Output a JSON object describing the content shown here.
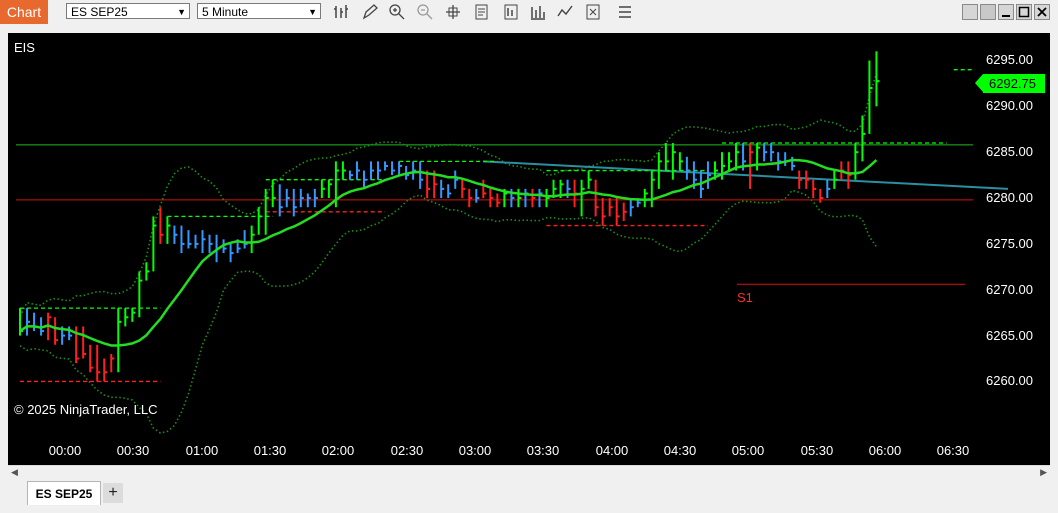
{
  "window": {
    "tab_label": "Chart",
    "tab_color": "#e8692d"
  },
  "toolbar": {
    "instrument_select": "ES SEP25",
    "interval_select": "5 Minute",
    "icons": [
      "bar-type-icon",
      "drawing-tool-icon",
      "zoom-in-icon",
      "zoom-out-icon",
      "crosshair-icon",
      "data-box-icon",
      "chart-properties-icon",
      "strategies-icon",
      "indicators-icon",
      "chart-trader-icon",
      "more-icon"
    ]
  },
  "chart": {
    "instrument_label": "EIS",
    "copyright": "© 2025 NinjaTrader, LLC",
    "annotation_s1": "S1",
    "current_price": "6292.75",
    "price_axis": [
      "6295.00",
      "6290.00",
      "6285.00",
      "6280.00",
      "6275.00",
      "6270.00",
      "6265.00",
      "6260.00"
    ],
    "time_axis": [
      "00:00",
      "00:30",
      "01:00",
      "01:30",
      "02:00",
      "02:30",
      "03:00",
      "03:30",
      "04:00",
      "04:30",
      "05:00",
      "05:30",
      "06:00",
      "06:30"
    ],
    "colors": {
      "up": "#00ff00",
      "down": "#ff2020",
      "neutral": "#3399ff",
      "ma": "#22dd22",
      "bollinger": "#1a8f1a",
      "resistance": "#22bb22",
      "support": "#dd1111",
      "trend": "#2a8fa0"
    }
  },
  "chart_data": {
    "type": "ohlc",
    "y_range": [
      6257,
      6298
    ],
    "bars": [
      [
        6268,
        6265,
        6265.5,
        "g"
      ],
      [
        6268,
        6265,
        6266.5,
        "b"
      ],
      [
        6267.5,
        6265.5,
        6266,
        "b"
      ],
      [
        6267,
        6265,
        6265.5,
        "b"
      ],
      [
        6267.5,
        6264.5,
        6267,
        "r"
      ],
      [
        6267,
        6264,
        6264.5,
        "r"
      ],
      [
        6266,
        6264,
        6265,
        "b"
      ],
      [
        6266,
        6264.5,
        6265,
        "b"
      ],
      [
        6266,
        6262,
        6262.5,
        "r"
      ],
      [
        6266,
        6262.5,
        6263,
        "r"
      ],
      [
        6264,
        6261,
        6261.5,
        "r"
      ],
      [
        6264,
        6260,
        6261,
        "r"
      ],
      [
        6262.5,
        6260,
        6261,
        "r"
      ],
      [
        6263,
        6261,
        6262.5,
        "r"
      ],
      [
        6268,
        6261,
        6266.5,
        "g"
      ],
      [
        6268,
        6266,
        6267,
        "g"
      ],
      [
        6268,
        6266.5,
        6267.5,
        "g"
      ],
      [
        6272,
        6267,
        6271,
        "g"
      ],
      [
        6273,
        6271,
        6272,
        "g"
      ],
      [
        6278,
        6272,
        6277,
        "g"
      ],
      [
        6279,
        6275,
        6276,
        "r"
      ],
      [
        6278,
        6275,
        6277,
        "g"
      ],
      [
        6277,
        6275,
        6276,
        "b"
      ],
      [
        6277,
        6274,
        6275,
        "b"
      ],
      [
        6276.5,
        6274.5,
        6275,
        "b"
      ],
      [
        6276,
        6274.5,
        6275,
        "b"
      ],
      [
        6276.5,
        6274,
        6275.5,
        "b"
      ],
      [
        6276,
        6274,
        6275,
        "b"
      ],
      [
        6276,
        6273,
        6274.5,
        "b"
      ],
      [
        6275.5,
        6274,
        6274.5,
        "b"
      ],
      [
        6275,
        6273,
        6274,
        "b"
      ],
      [
        6275.5,
        6274,
        6274.5,
        "b"
      ],
      [
        6276.5,
        6274.5,
        6275,
        "b"
      ],
      [
        6277,
        6274,
        6276,
        "g"
      ],
      [
        6279,
        6276,
        6278,
        "g"
      ],
      [
        6281,
        6276,
        6280,
        "g"
      ],
      [
        6282,
        6279,
        6280,
        "g"
      ],
      [
        6281.5,
        6278,
        6279,
        "b"
      ],
      [
        6281,
        6279,
        6280,
        "b"
      ],
      [
        6281,
        6278,
        6279,
        "b"
      ],
      [
        6281,
        6279,
        6280,
        "b"
      ],
      [
        6280.5,
        6279,
        6280,
        "b"
      ],
      [
        6281,
        6279,
        6280,
        "b"
      ],
      [
        6282,
        6280,
        6281,
        "g"
      ],
      [
        6282,
        6280,
        6281.5,
        "g"
      ],
      [
        6284,
        6279,
        6283,
        "g"
      ],
      [
        6284,
        6282,
        6283,
        "g"
      ],
      [
        6283,
        6282,
        6282.5,
        "b"
      ],
      [
        6284,
        6282,
        6283,
        "b"
      ],
      [
        6283,
        6281,
        6282,
        "b"
      ],
      [
        6284,
        6282,
        6283,
        "b"
      ],
      [
        6284,
        6282,
        6283,
        "b"
      ],
      [
        6284,
        6283,
        6283.5,
        "b"
      ],
      [
        6284,
        6282.5,
        6283,
        "b"
      ],
      [
        6284,
        6282.5,
        6283.5,
        "b"
      ],
      [
        6283.5,
        6282,
        6282.5,
        "b"
      ],
      [
        6284,
        6282,
        6283,
        "b"
      ],
      [
        6284,
        6281,
        6282,
        "b"
      ],
      [
        6283,
        6280,
        6281,
        "r"
      ],
      [
        6283,
        6280,
        6281.5,
        "r"
      ],
      [
        6282,
        6280,
        6281,
        "b"
      ],
      [
        6281.5,
        6280,
        6280.5,
        "b"
      ],
      [
        6283,
        6281,
        6282,
        "b"
      ],
      [
        6282,
        6280,
        6281,
        "r"
      ],
      [
        6281,
        6279,
        6280,
        "r"
      ],
      [
        6281,
        6279.5,
        6280,
        "b"
      ],
      [
        6282,
        6280,
        6280.5,
        "r"
      ],
      [
        6281,
        6279,
        6280,
        "r"
      ],
      [
        6280.5,
        6279,
        6279.5,
        "r"
      ],
      [
        6281,
        6279,
        6280.5,
        "g"
      ],
      [
        6281,
        6279,
        6280,
        "b"
      ],
      [
        6281,
        6279,
        6280,
        "g"
      ],
      [
        6281,
        6279,
        6280.5,
        "b"
      ],
      [
        6281,
        6279,
        6280,
        "r"
      ],
      [
        6281,
        6279,
        6280.5,
        "b"
      ],
      [
        6281,
        6279,
        6280,
        "g"
      ],
      [
        6282,
        6280,
        6281,
        "g"
      ],
      [
        6282,
        6280,
        6281.5,
        "g"
      ],
      [
        6282,
        6280,
        6281,
        "b"
      ],
      [
        6282,
        6279,
        6280.5,
        "r"
      ],
      [
        6282,
        6278,
        6281,
        "g"
      ],
      [
        6283,
        6281,
        6282,
        "g"
      ],
      [
        6282,
        6278,
        6279,
        "r"
      ],
      [
        6280,
        6277,
        6278,
        "r"
      ],
      [
        6280,
        6278,
        6279,
        "r"
      ],
      [
        6280,
        6277,
        6278,
        "r"
      ],
      [
        6279.5,
        6277.5,
        6278.5,
        "r"
      ],
      [
        6280,
        6278,
        6279,
        "b"
      ],
      [
        6280,
        6279,
        6279.5,
        "b"
      ],
      [
        6281,
        6279,
        6280.5,
        "g"
      ],
      [
        6283,
        6279,
        6282,
        "g"
      ],
      [
        6285,
        6281,
        6284,
        "g"
      ],
      [
        6286,
        6283,
        6284,
        "g"
      ],
      [
        6286,
        6282,
        6285,
        "g"
      ],
      [
        6285,
        6283,
        6284,
        "g"
      ],
      [
        6284.5,
        6282,
        6283,
        "b"
      ],
      [
        6284,
        6281,
        6282,
        "b"
      ],
      [
        6283,
        6280,
        6281,
        "b"
      ],
      [
        6284,
        6281,
        6282.5,
        "b"
      ],
      [
        6284,
        6282,
        6283,
        "g"
      ],
      [
        6285,
        6282,
        6283.5,
        "g"
      ],
      [
        6285,
        6283,
        6284,
        "g"
      ],
      [
        6286,
        6283,
        6285,
        "g"
      ],
      [
        6286,
        6283,
        6284,
        "b"
      ],
      [
        6286,
        6281,
        6285,
        "r"
      ],
      [
        6286,
        6283,
        6285.5,
        "g"
      ],
      [
        6286,
        6284,
        6285,
        "b"
      ],
      [
        6286,
        6284,
        6285,
        "b"
      ],
      [
        6285,
        6283,
        6284,
        "b"
      ],
      [
        6285,
        6283.5,
        6284,
        "b"
      ],
      [
        6284.5,
        6283,
        6283.5,
        "b"
      ],
      [
        6283,
        6281,
        6282,
        "r"
      ],
      [
        6283,
        6281,
        6282,
        "r"
      ],
      [
        6282,
        6280,
        6281,
        "r"
      ],
      [
        6281,
        6279.5,
        6280,
        "r"
      ],
      [
        6282,
        6280,
        6281,
        "b"
      ],
      [
        6283,
        6281,
        6282,
        "g"
      ],
      [
        6284,
        6282,
        6283,
        "r"
      ],
      [
        6284,
        6281,
        6282.5,
        "r"
      ],
      [
        6286,
        6282,
        6285,
        "g"
      ],
      [
        6289,
        6284,
        6287,
        "g"
      ],
      [
        6295,
        6287,
        6292,
        "g"
      ],
      [
        6296,
        6290,
        6292.75,
        "g"
      ]
    ],
    "moving_average": [
      [
        6266,
        6266
      ],
      [
        6265.5,
        6265.5
      ],
      [
        6266.5,
        6266.5
      ],
      [
        6270,
        6270
      ],
      [
        6272.5,
        6272.5
      ],
      [
        6274,
        6274
      ],
      [
        6274.5,
        6274.5
      ],
      [
        6276.5,
        6276.5
      ],
      [
        6278.5,
        6278.5
      ],
      [
        6280.5,
        6280.5
      ],
      [
        6280.5,
        6280.5
      ],
      [
        6281,
        6281
      ],
      [
        6280.5,
        6280.5
      ],
      [
        6282,
        6282
      ],
      [
        6282.5,
        6282.5
      ],
      [
        6284.5,
        6284.5
      ]
    ],
    "resistance_level": 6285.8,
    "support_level": 6279.8,
    "s1_level": 6270.6
  }
}
